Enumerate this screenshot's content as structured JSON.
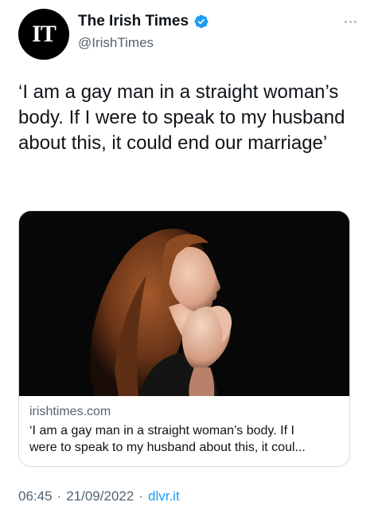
{
  "account": {
    "avatar_text": "IT",
    "display_name": "The Irish Times",
    "handle": "@IrishTimes",
    "verified": true
  },
  "tweet": {
    "text": "‘I am a gay man in a straight woman’s body. If I were to speak to my husband about this, it could end our marriage’"
  },
  "card": {
    "image_icon": "woman-praying-photo",
    "domain": "irishtimes.com",
    "title_line1": "‘I am a gay man in a straight woman’s body. If I",
    "title_line2": "were to speak to my husband about this, it coul..."
  },
  "meta": {
    "time": "06:45",
    "separator1": "·",
    "date": "21/09/2022",
    "separator2": "·",
    "source": "dlvr.it"
  },
  "colors": {
    "verified_blue": "#1d9bf0",
    "text_secondary": "#536471",
    "link_blue": "#1d9bf0"
  }
}
